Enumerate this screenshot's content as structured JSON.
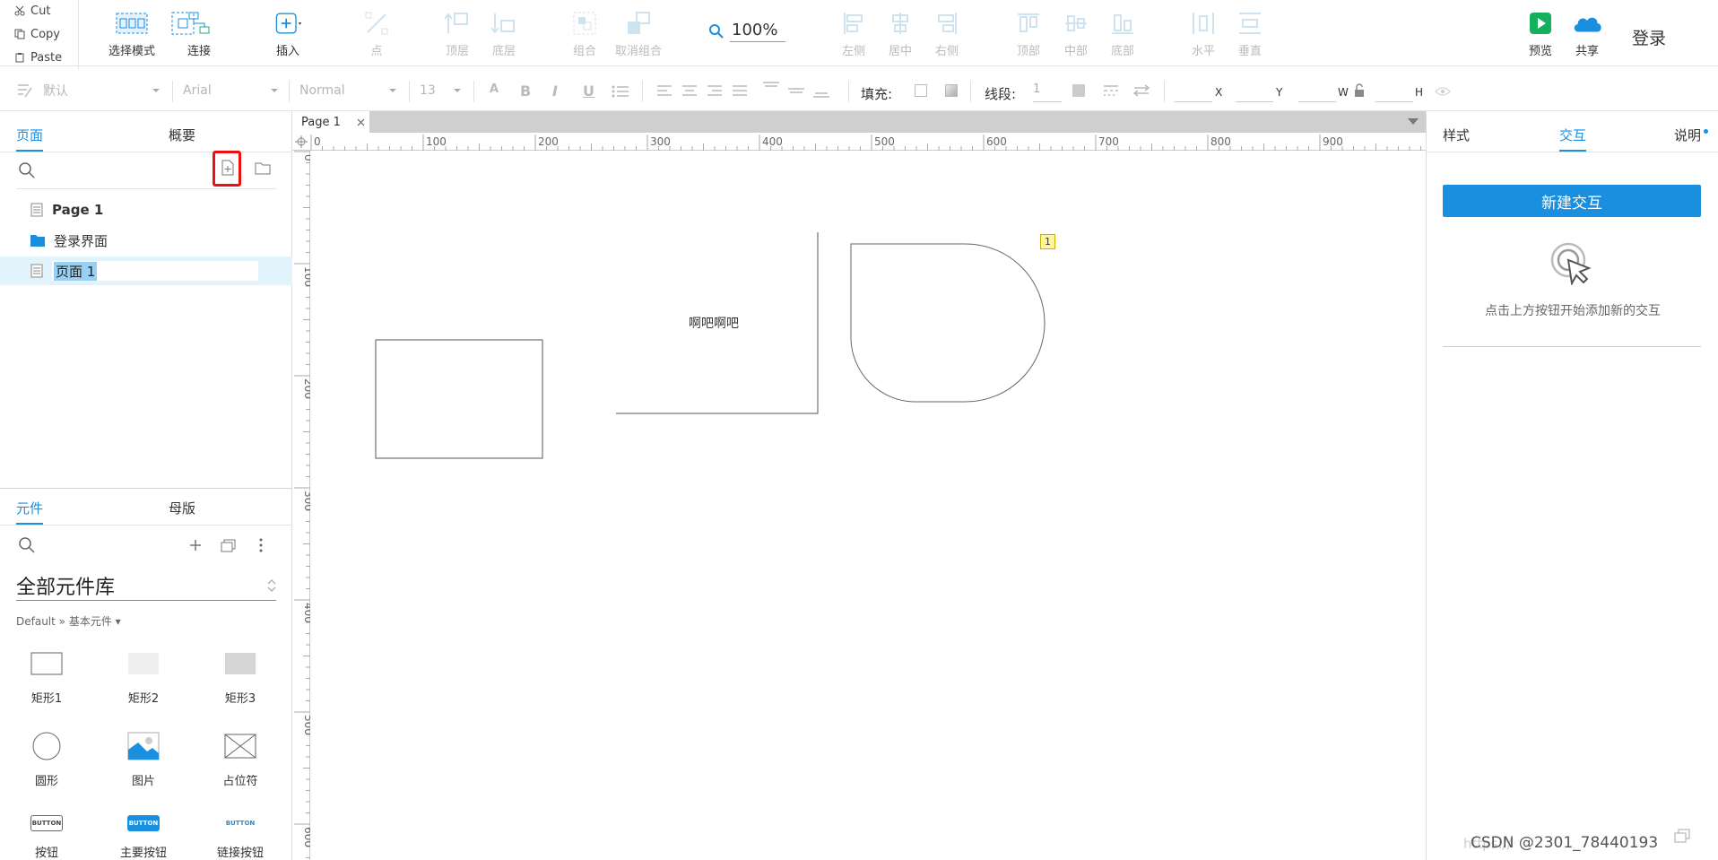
{
  "clipboard": {
    "cut": "Cut",
    "copy": "Copy",
    "paste": "Paste"
  },
  "toolbar": {
    "select_mode": "选择模式",
    "connect": "连接",
    "insert": "插入",
    "point": "点",
    "top_layer": "顶层",
    "bottom_layer": "底层",
    "group": "组合",
    "ungroup": "取消组合",
    "zoom": "100%",
    "align_left": "左侧",
    "align_center": "居中",
    "align_right": "右侧",
    "align_top": "顶部",
    "align_middle": "中部",
    "align_bottom": "底部",
    "distribute_h": "水平",
    "distribute_v": "垂直",
    "preview": "预览",
    "share": "共享",
    "login": "登录"
  },
  "format": {
    "style": "默认",
    "font": "Arial",
    "weight": "Normal",
    "size": "13",
    "fill_label": "填充:",
    "stroke_label": "线段:",
    "stroke_value": "1",
    "x": "X",
    "y": "Y",
    "w": "W",
    "h": "H"
  },
  "left": {
    "tabs": [
      "页面",
      "概要"
    ],
    "pages": [
      {
        "label": "Page 1"
      },
      {
        "label": "登录界面"
      },
      {
        "label": "页面 1"
      }
    ],
    "widget_tabs": [
      "元件",
      "母版"
    ],
    "library": "全部元件库",
    "breadcrumb": "Default » 基本元件 ▾",
    "widgets": [
      "矩形1",
      "矩形2",
      "矩形3",
      "圆形",
      "图片",
      "占位符",
      "按钮",
      "主要按钮",
      "链接按钮"
    ],
    "button_text": "BUTTON"
  },
  "canvas": {
    "tab": "Page 1",
    "ruler_h": [
      "0",
      "100",
      "200",
      "300",
      "400",
      "500",
      "600",
      "700",
      "800",
      "900"
    ],
    "ruler_v": [
      "0",
      "100",
      "200",
      "300",
      "400",
      "500",
      "600"
    ],
    "text_widget": "啊吧啊吧",
    "note_badge": "1"
  },
  "right": {
    "tabs": [
      "样式",
      "交互",
      "说明"
    ],
    "new_interaction": "新建交互",
    "hint": "点击上方按钮开始添加新的交互"
  },
  "watermark": "CSDN @2301_78440193",
  "watermark_faint": "https://"
}
